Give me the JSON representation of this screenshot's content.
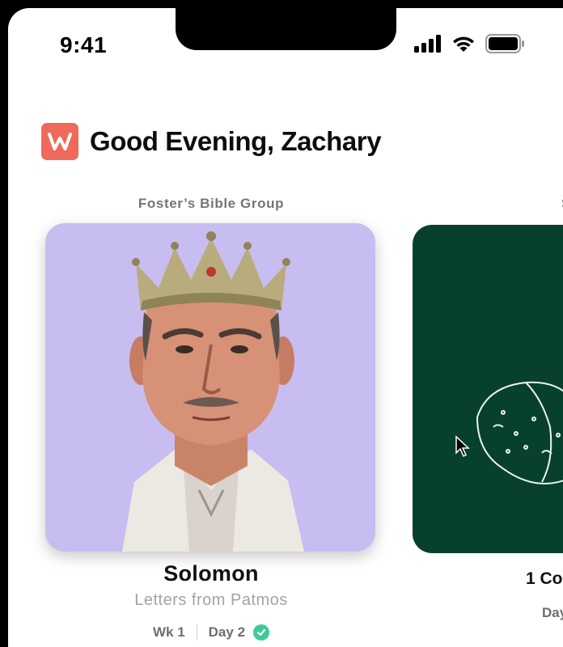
{
  "status_bar": {
    "time": "9:41",
    "icons": [
      "cellular-signal-icon",
      "wifi-icon",
      "battery-icon"
    ]
  },
  "header": {
    "logo_letter": "W",
    "greeting": "Good Evening, Zachary",
    "accent_color": "#ef6a5a"
  },
  "cards": [
    {
      "group": "Foster’s Bible Group",
      "title": "Solomon",
      "subtitle": "Letters from Patmos",
      "week": "Wk 1",
      "day": "Day 2",
      "completed": true,
      "background": "#c8bdf0"
    },
    {
      "group": "S",
      "title": "1 Co",
      "day": "Day",
      "background": "#08402f"
    }
  ]
}
